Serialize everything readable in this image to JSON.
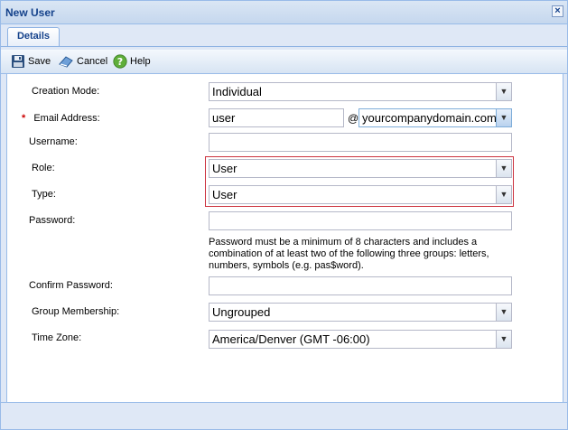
{
  "window": {
    "title": "New User"
  },
  "tabs": [
    {
      "label": "Details"
    }
  ],
  "toolbar": {
    "save_label": "Save",
    "cancel_label": "Cancel",
    "help_label": "Help"
  },
  "form": {
    "creation_mode": {
      "label": "Creation Mode:",
      "value": "Individual"
    },
    "email": {
      "required_mark": "*",
      "label": "Email Address:",
      "user_value": "user",
      "at_sign": "@",
      "domain_value": "yourcompanydomain.com"
    },
    "username": {
      "label": "Username:",
      "value": ""
    },
    "role": {
      "label": "Role:",
      "value": "User"
    },
    "type": {
      "label": "Type:",
      "value": "User"
    },
    "password": {
      "label": "Password:",
      "value": "",
      "help": "Password must be a minimum of 8 characters and includes a combination of at least two of the following three groups: letters, numbers, symbols (e.g. pas$word)."
    },
    "confirm_password": {
      "label": "Confirm Password:",
      "value": ""
    },
    "group_membership": {
      "label": "Group Membership:",
      "value": "Ungrouped"
    },
    "time_zone": {
      "label": "Time Zone:",
      "value": "America/Denver (GMT -06:00)"
    }
  },
  "icons": {
    "save": "floppy-disk-icon",
    "cancel": "cancel-icon",
    "help": "help-icon",
    "close": "close-icon",
    "dropdown": "chevron-down-icon"
  },
  "colors": {
    "title_text": "#15428b",
    "panel_bg": "#dfe8f6",
    "border": "#99bbe8",
    "highlight": "#cc3340",
    "required": "#cc0000"
  }
}
